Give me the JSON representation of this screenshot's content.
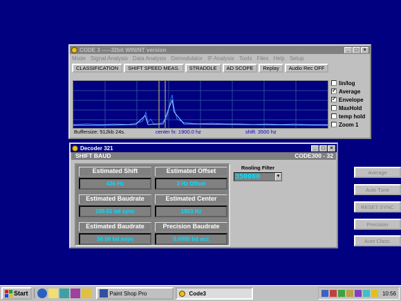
{
  "desktop": {},
  "code3": {
    "title": "CODE 3  -----32bit WIN/NT version",
    "menu": [
      "Mode",
      "Signal Analysis",
      "Data Analysis",
      "Demodulator",
      "IF Analysis",
      "Tools",
      "Files",
      "Help",
      "Setup"
    ],
    "toolbar": [
      "CLASSIFICATION",
      "SHIFT SPEED MEAS.",
      "STRADDLE",
      "AD SCOPE",
      "Replay",
      "Audio Rec OFF"
    ],
    "status": {
      "buffersize": "Buffersize: 512kb  24s.",
      "center": "center fx:  1900.0 hz",
      "shift": "shift: 3500 hz"
    },
    "checks": [
      {
        "label": "lin/log",
        "checked": false
      },
      {
        "label": "Average",
        "checked": true
      },
      {
        "label": "Envelope",
        "checked": true
      },
      {
        "label": "MaxHold",
        "checked": false
      },
      {
        "label": "temp hold",
        "checked": false
      },
      {
        "label": "Zoom 1",
        "checked": false
      }
    ],
    "window_buttons": [
      "_",
      "□",
      "×"
    ]
  },
  "decoder": {
    "title": "Decoder 321",
    "subtitle_left": "SHIFT BAUD",
    "subtitle_right": "CODE300 - 32",
    "fields": [
      {
        "label": "Estimated  Shift",
        "value": "436 Hz"
      },
      {
        "label": "Estimated  Offset",
        "value": "3 Hz Offset"
      },
      {
        "label": "Estimated Baudrate",
        "value": "100.01 bd sync"
      },
      {
        "label": "Estimated  Center",
        "value": "1903 Hz"
      },
      {
        "label": "Estimated  Baudrate",
        "value": "50.00 bd asyn"
      },
      {
        "label": "Precision  Baudrate",
        "value": "0.0000 bd acc"
      }
    ],
    "rooling_filter": {
      "label": "Rooling Filter",
      "value": "350000"
    },
    "buttons": [
      "Average",
      "Auto Tune",
      "RESET  SYNC",
      "Precision",
      "Auto Class."
    ],
    "window_buttons": [
      "_",
      "□",
      "×"
    ]
  },
  "taskbar": {
    "start": "Start",
    "tasks": [
      "Paint Shop Pro",
      "Code3"
    ],
    "clock": "10:56"
  },
  "colors": {
    "desktop": "#000080",
    "value_text": "#00e0ff",
    "spectrum_bg": "#000080",
    "trace": "#3070ff"
  }
}
